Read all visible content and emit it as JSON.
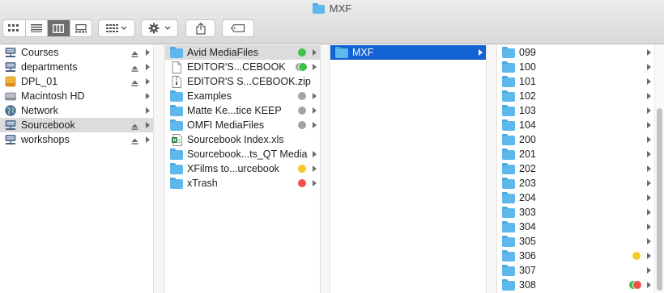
{
  "window": {
    "title": "MXF"
  },
  "toolbar": {
    "view_modes": [
      "icon-view-icon",
      "list-view-icon",
      "column-view-icon",
      "gallery-view-icon"
    ],
    "active_view": 2
  },
  "sidebar": {
    "items": [
      {
        "label": "Courses",
        "icon": "network-drive-icon",
        "eject": true,
        "selected": false
      },
      {
        "label": "departments",
        "icon": "network-drive-icon",
        "eject": true,
        "selected": false
      },
      {
        "label": "DPL_01",
        "icon": "external-drive-icon",
        "eject": true,
        "selected": false
      },
      {
        "label": "Macintosh HD",
        "icon": "hard-drive-icon",
        "eject": false,
        "selected": false
      },
      {
        "label": "Network",
        "icon": "globe-icon",
        "eject": false,
        "selected": false
      },
      {
        "label": "Sourcebook",
        "icon": "network-drive-icon",
        "eject": true,
        "selected": true
      },
      {
        "label": "workshops",
        "icon": "network-drive-icon",
        "eject": true,
        "selected": false
      }
    ]
  },
  "column2": {
    "items": [
      {
        "label": "Avid MediaFiles",
        "icon": "folder-icon",
        "tag": "green",
        "chevron": true,
        "selected": true
      },
      {
        "label": "EDITOR'S...CEBOOK",
        "icon": "document-icon",
        "tag": "gray-green",
        "chevron": true,
        "selected": false
      },
      {
        "label": "EDITOR'S S...CEBOOK.zip",
        "icon": "zip-icon",
        "tag": "",
        "chevron": false,
        "selected": false
      },
      {
        "label": "Examples",
        "icon": "folder-icon",
        "tag": "gray",
        "chevron": true,
        "selected": false
      },
      {
        "label": "Matte Ke...tice KEEP",
        "icon": "folder-icon",
        "tag": "gray",
        "chevron": true,
        "selected": false
      },
      {
        "label": "OMFI MediaFiles",
        "icon": "folder-icon",
        "tag": "gray",
        "chevron": true,
        "selected": false
      },
      {
        "label": "Sourcebook Index.xls",
        "icon": "excel-icon",
        "tag": "",
        "chevron": false,
        "selected": false
      },
      {
        "label": "Sourcebook...ts_QT Media",
        "icon": "folder-icon",
        "tag": "",
        "chevron": true,
        "selected": false
      },
      {
        "label": "XFilms to...urcebook",
        "icon": "folder-icon",
        "tag": "yellow",
        "chevron": true,
        "selected": false
      },
      {
        "label": "xTrash",
        "icon": "folder-icon",
        "tag": "red",
        "chevron": true,
        "selected": false
      }
    ]
  },
  "column3": {
    "items": [
      {
        "label": "MXF",
        "icon": "folder-icon",
        "tag": "",
        "chevron": true,
        "selected": true
      }
    ]
  },
  "column4": {
    "items": [
      {
        "label": "099",
        "tag": ""
      },
      {
        "label": "100",
        "tag": ""
      },
      {
        "label": "101",
        "tag": ""
      },
      {
        "label": "102",
        "tag": ""
      },
      {
        "label": "103",
        "tag": ""
      },
      {
        "label": "104",
        "tag": ""
      },
      {
        "label": "200",
        "tag": ""
      },
      {
        "label": "201",
        "tag": ""
      },
      {
        "label": "202",
        "tag": ""
      },
      {
        "label": "203",
        "tag": ""
      },
      {
        "label": "204",
        "tag": ""
      },
      {
        "label": "303",
        "tag": ""
      },
      {
        "label": "304",
        "tag": ""
      },
      {
        "label": "305",
        "tag": ""
      },
      {
        "label": "306",
        "tag": "yellow"
      },
      {
        "label": "307",
        "tag": ""
      },
      {
        "label": "308",
        "tag": "green-red"
      }
    ]
  },
  "colors": {
    "selection_blue": "#1362d6",
    "selection_grey": "#dcdcdc",
    "folder_blue": "#5fb8ec",
    "tag_green": "#3cc24a",
    "tag_gray": "#a3a3a3",
    "tag_yellow": "#f5c928",
    "tag_red": "#f0514b"
  }
}
